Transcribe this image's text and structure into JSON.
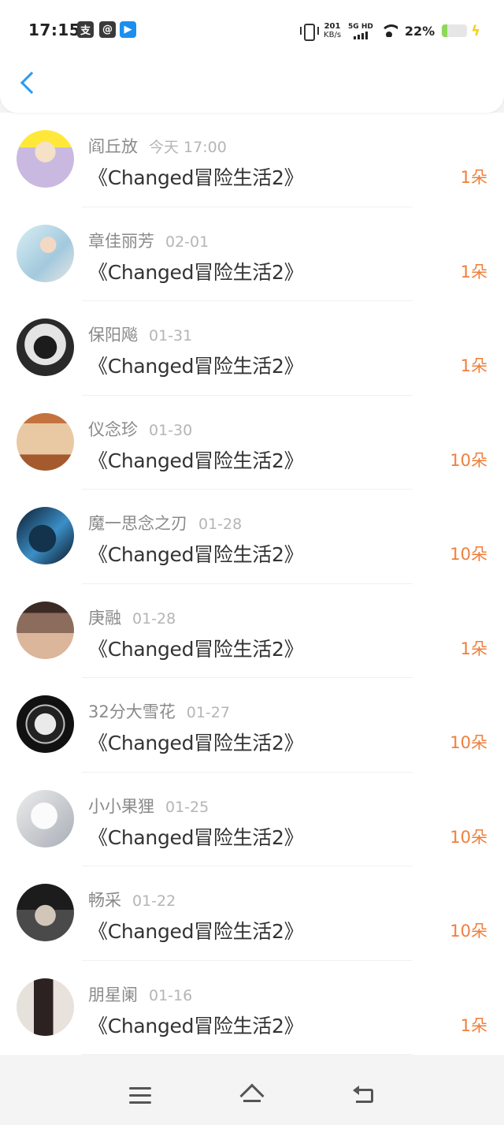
{
  "status_bar": {
    "time": "17:15",
    "icons": [
      "pay-icon",
      "mail-icon",
      "app-icon"
    ],
    "speed_value": "201",
    "speed_unit": "KB/s",
    "network": "5G HD",
    "battery_percent": "22%",
    "battery_level": 0.22
  },
  "header": {
    "back_icon": "chevron-left-icon",
    "accent_color": "#2b9af3"
  },
  "items": [
    {
      "name": "阎丘放",
      "date": "今天 17:00",
      "title": "《Changed冒险生活2》",
      "count": "1朵"
    },
    {
      "name": "章佳丽芳",
      "date": "02-01",
      "title": "《Changed冒险生活2》",
      "count": "1朵"
    },
    {
      "name": "保阳飚",
      "date": "01-31",
      "title": "《Changed冒险生活2》",
      "count": "1朵"
    },
    {
      "name": "仪念珍",
      "date": "01-30",
      "title": "《Changed冒险生活2》",
      "count": "10朵"
    },
    {
      "name": "魔一思念之刃",
      "date": "01-28",
      "title": "《Changed冒险生活2》",
      "count": "10朵"
    },
    {
      "name": "庚融",
      "date": "01-28",
      "title": "《Changed冒险生活2》",
      "count": "1朵"
    },
    {
      "name": "32分大雪花",
      "date": "01-27",
      "title": "《Changed冒险生活2》",
      "count": "10朵"
    },
    {
      "name": "小小果狸",
      "date": "01-25",
      "title": "《Changed冒险生活2》",
      "count": "10朵"
    },
    {
      "name": "畅采",
      "date": "01-22",
      "title": "《Changed冒险生活2》",
      "count": "10朵"
    },
    {
      "name": "朋星阑",
      "date": "01-16",
      "title": "《Changed冒险生活2》",
      "count": "1朵"
    }
  ],
  "nav_bar": {
    "icons": [
      "menu-icon",
      "home-icon",
      "back-icon"
    ]
  },
  "colors": {
    "count": "#ee7f3c",
    "name": "#8a8a8a",
    "date": "#b5b5b5"
  }
}
